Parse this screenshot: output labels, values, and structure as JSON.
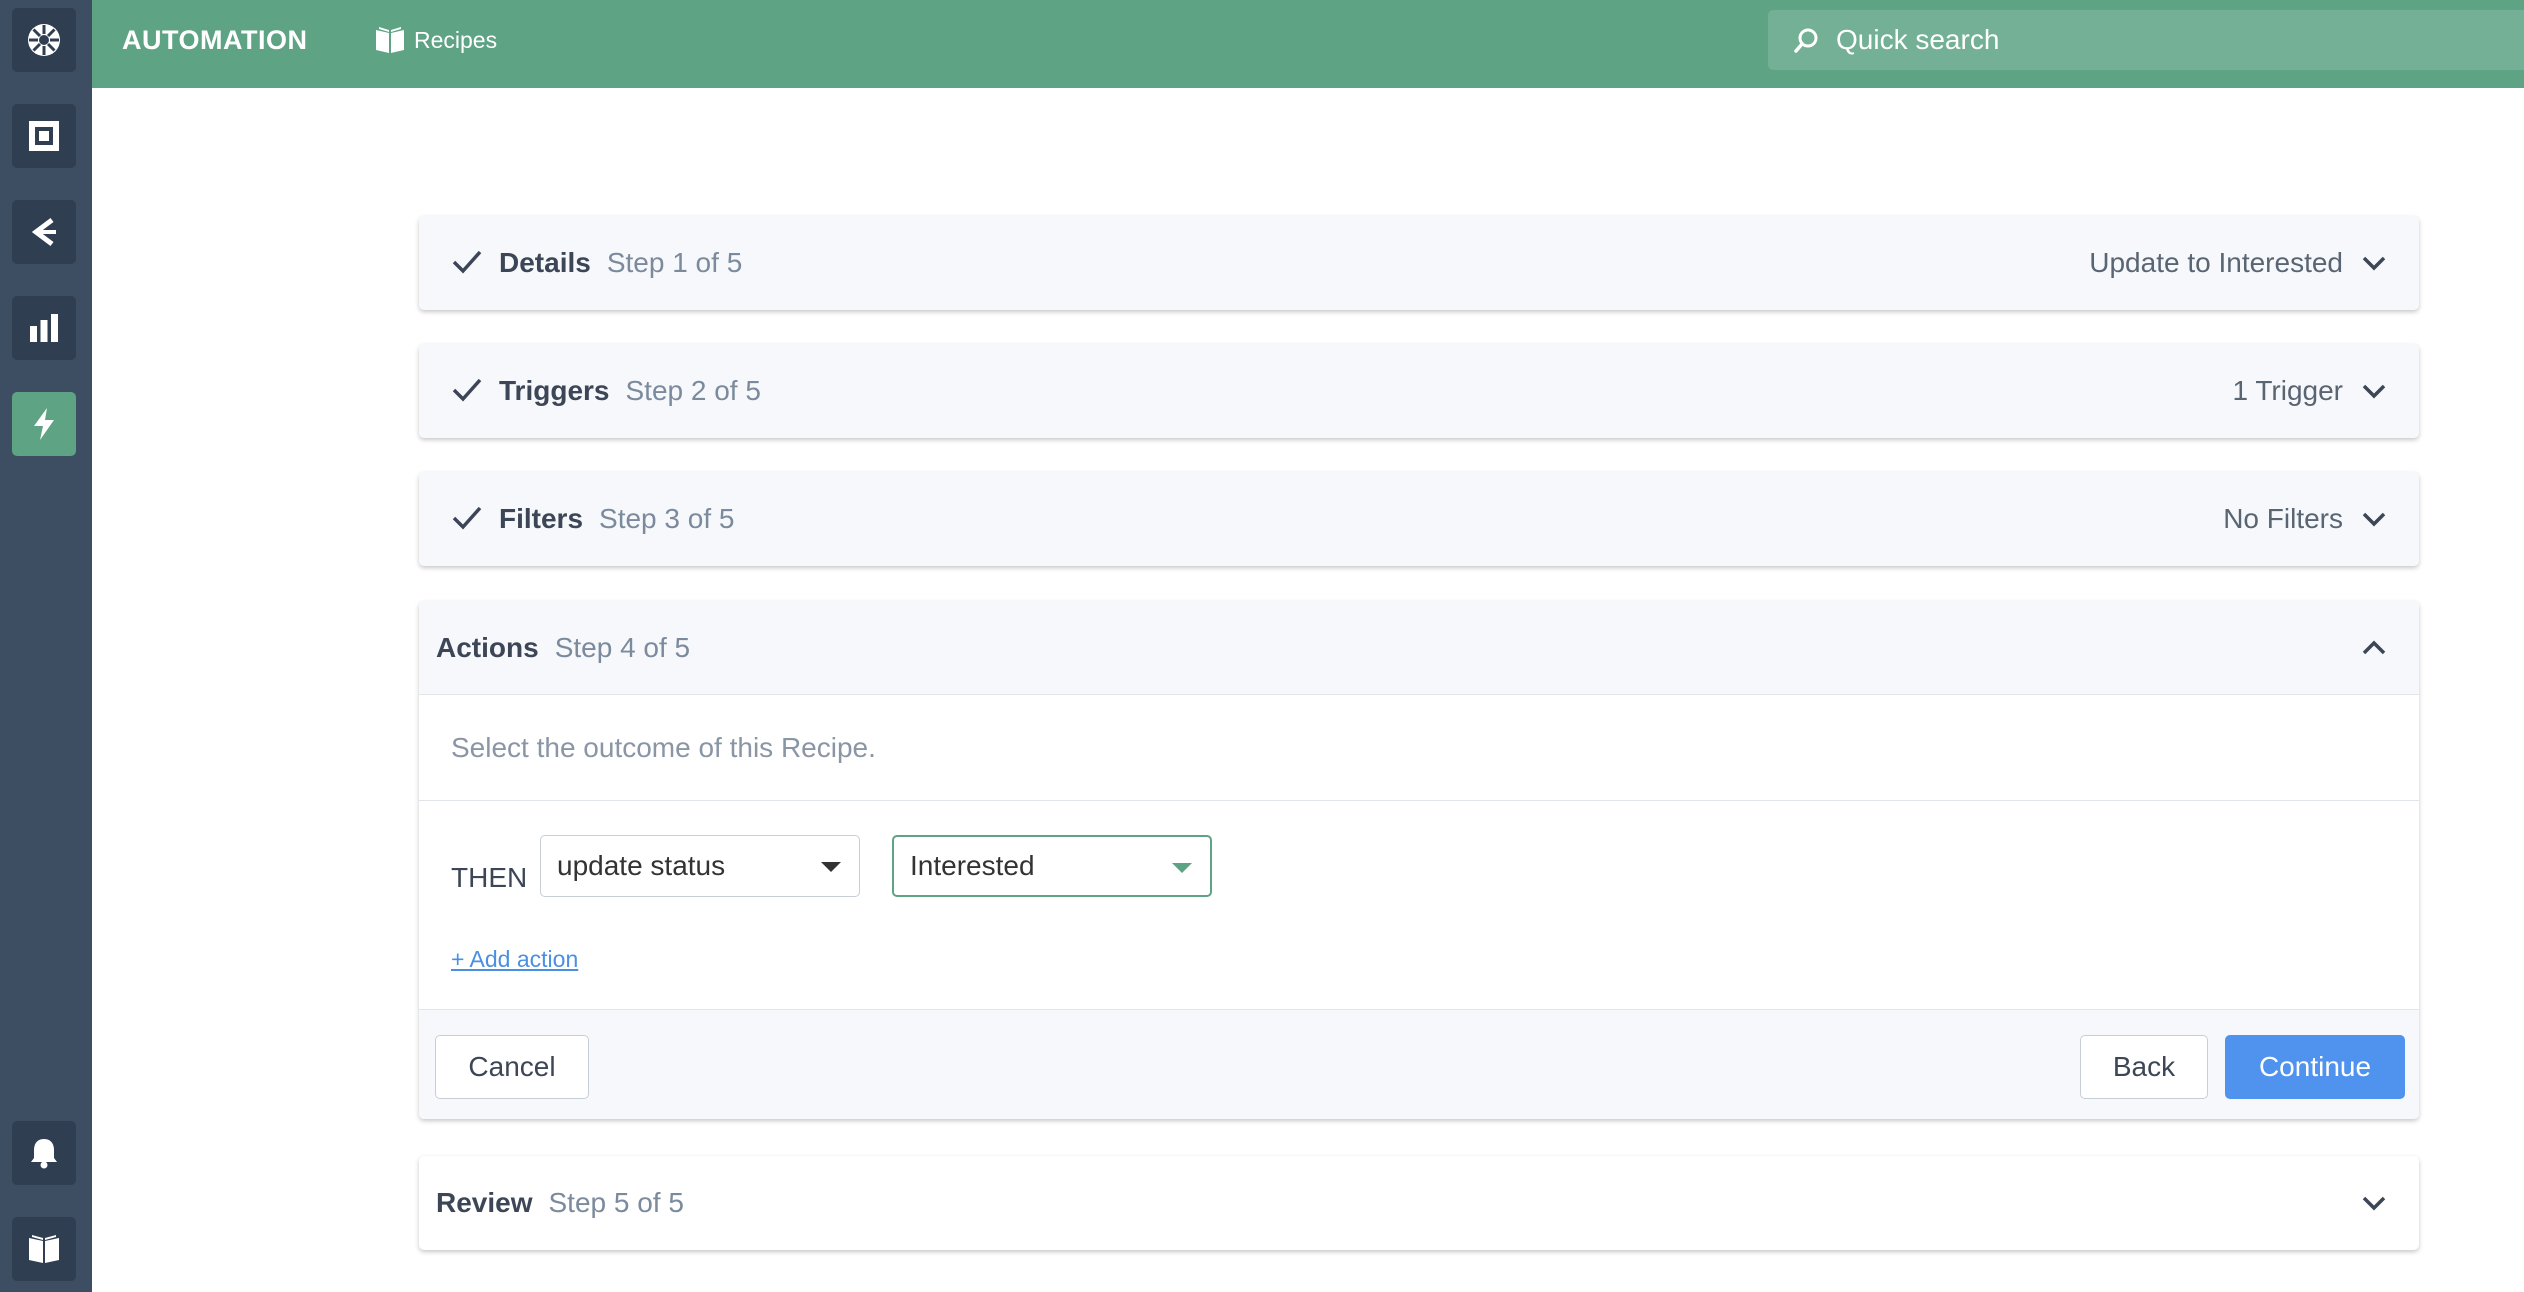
{
  "app": {
    "title": "AUTOMATION",
    "nav_recipes": "Recipes",
    "search_placeholder": "Quick search"
  },
  "rail": {
    "items": [
      {
        "icon": "logo-icon"
      },
      {
        "icon": "square-icon"
      },
      {
        "icon": "chevron-left-icon"
      },
      {
        "icon": "bar-chart-icon"
      },
      {
        "icon": "lightning-icon",
        "active": true
      },
      {
        "icon": "bell-icon"
      },
      {
        "icon": "book-icon"
      }
    ]
  },
  "steps": {
    "details": {
      "title": "Details",
      "sub": "Step 1 of 5",
      "summary": "Update to Interested",
      "completed": true
    },
    "triggers": {
      "title": "Triggers",
      "sub": "Step 2 of 5",
      "summary": "1 Trigger",
      "completed": true
    },
    "filters": {
      "title": "Filters",
      "sub": "Step 3 of 5",
      "summary": "No Filters",
      "completed": true
    },
    "actions": {
      "title": "Actions",
      "sub": "Step 4 of 5",
      "description": "Select the outcome of this Recipe.",
      "then_label": "THEN",
      "action_select": "update status",
      "status_select": "Interested",
      "add_action": "+ Add action",
      "cancel": "Cancel",
      "back": "Back",
      "continue": "Continue"
    },
    "review": {
      "title": "Review",
      "sub": "Step 5 of 5"
    }
  },
  "colors": {
    "brand_green": "#5da384",
    "rail_bg": "#3d4e62",
    "primary_blue": "#4f93ee"
  }
}
